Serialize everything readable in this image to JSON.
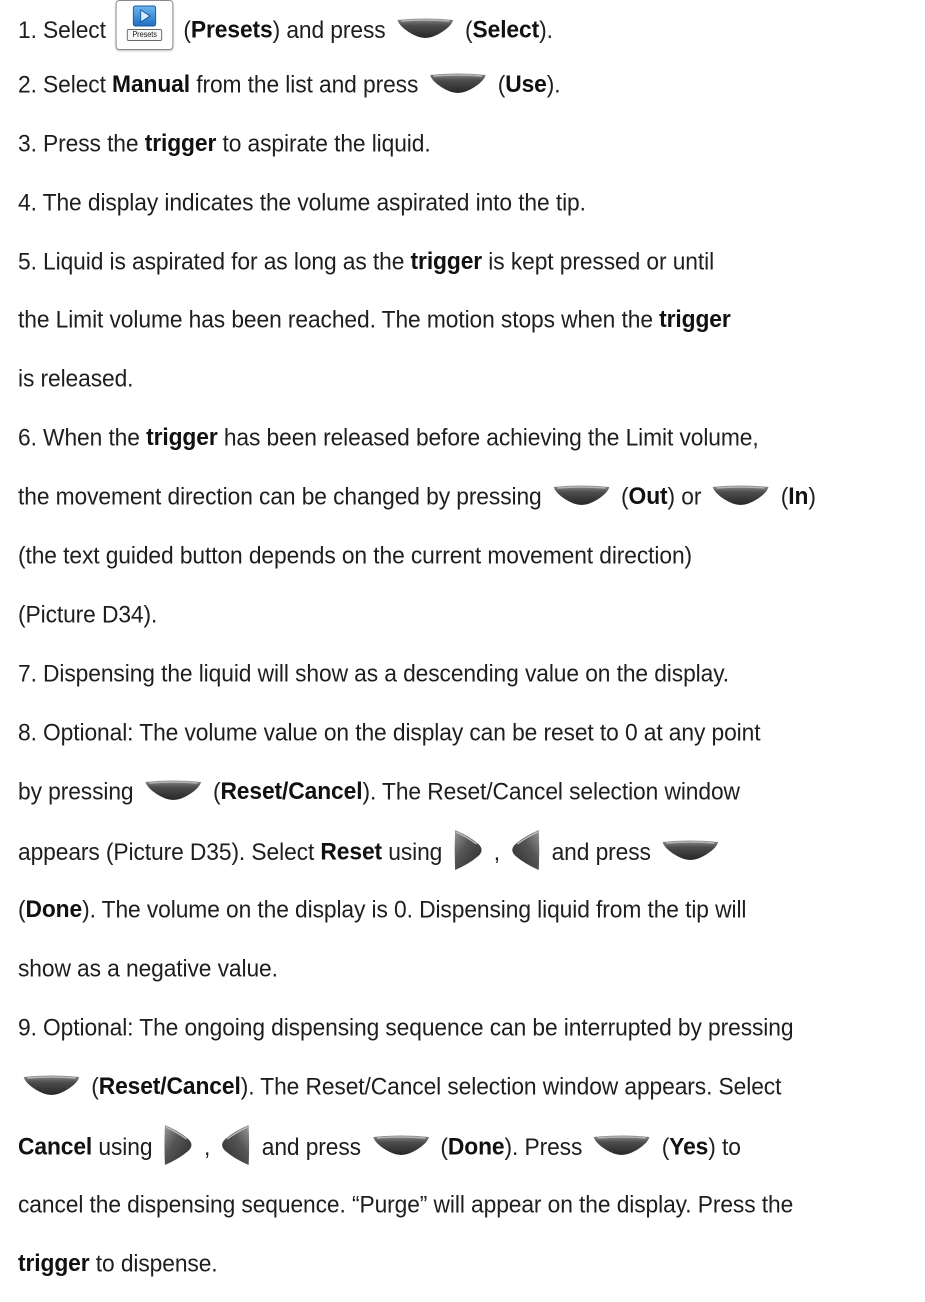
{
  "icons": {
    "softkey": "softkey-icon",
    "right_arrow": "right-arrow-key-icon",
    "left_arrow": "left-arrow-key-icon",
    "presets": "presets-icon"
  },
  "colors": {
    "softkey_gray": "#4d4d4d",
    "presets_blue": "#2a86d8"
  },
  "presets_caption": "Presets",
  "lines": [
    [
      "1.  Select ",
      "{presets}",
      " (",
      "**Presets",
      ") and press ",
      "{softkey}",
      " (",
      "**Select",
      ")."
    ],
    [
      "2.  Select ",
      "**Manual",
      " from the list and press ",
      "{softkey}",
      " (",
      "**Use",
      ")."
    ],
    [
      "3.  Press the ",
      "**trigger",
      " to aspirate the liquid."
    ],
    [
      "4.  The display indicates the volume aspirated into the tip."
    ],
    [
      "5.  Liquid is aspirated for as long as the ",
      "**trigger",
      " is kept pressed or until"
    ],
    [
      "the Limit volume has been reached. The motion stops when the ",
      "**trigger"
    ],
    [
      "is released."
    ],
    [
      "6.  When the ",
      "**trigger",
      " has been released before achieving the Limit volume,"
    ],
    [
      "the movement direction can be changed by pressing ",
      "{softkey}",
      "(",
      "**Out",
      ") or ",
      "{softkey}",
      "(",
      "**In",
      ")"
    ],
    [
      "(the text guided button depends on the current movement direction)"
    ],
    [
      "(Picture D34)."
    ],
    [
      "7.  Dispensing the liquid will show as a descending value on the display."
    ],
    [
      "8.  Optional: The volume value on the display can be reset to 0 at any point"
    ],
    [
      "by pressing  ",
      "{softkey}",
      " (",
      "**Reset/Cancel",
      "). The Reset/Cancel selection window"
    ],
    [
      "appears (Picture D35). Select ",
      "**Reset",
      " using ",
      "{right}",
      ", ",
      "{left}",
      " and press ",
      "{softkey}"
    ],
    [
      "(",
      "**Done",
      "). The volume on the display is 0. Dispensing liquid from the tip will"
    ],
    [
      "show as a negative value."
    ],
    [
      "9.  Optional: The ongoing dispensing sequence can be interrupted by pressing"
    ],
    [
      "{softkey}",
      " (",
      "**Reset/Cancel",
      "). The Reset/Cancel selection window appears. Select"
    ],
    [
      "**Cancel",
      " using ",
      "{right}",
      ", ",
      "{left}",
      " and press ",
      "{softkey}",
      " (",
      "**Done",
      "). Press  ",
      "{softkey}",
      " (",
      "**Yes",
      ") to"
    ],
    [
      "cancel the dispensing sequence. “Purge” will appear on the display. Press the"
    ],
    [
      "**trigger",
      " to dispense."
    ]
  ]
}
